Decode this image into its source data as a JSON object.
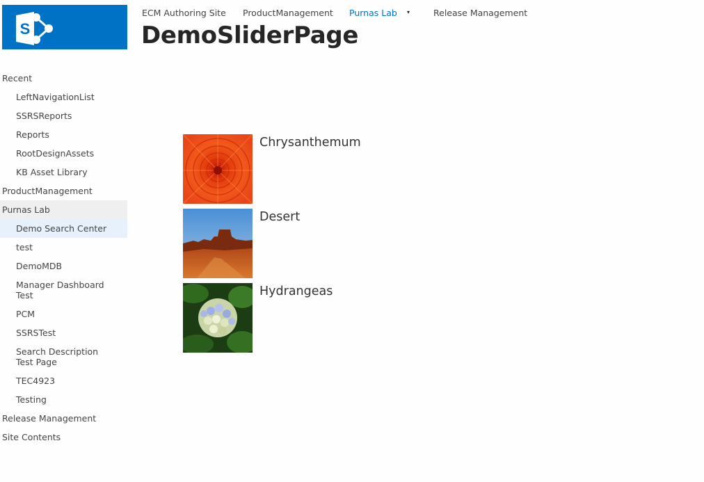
{
  "logo": {
    "icon": "sharepoint-logo-icon",
    "color": "#0072c6"
  },
  "topnav": {
    "items": [
      {
        "label": "ECM Authoring Site"
      },
      {
        "label": "ProductManagement"
      },
      {
        "label": "Purnas Lab",
        "selected": true
      },
      {
        "label": "Release Management"
      }
    ],
    "caret": "▾"
  },
  "page": {
    "title": "DemoSliderPage"
  },
  "leftnav": {
    "items": [
      {
        "label": "Recent"
      },
      {
        "label": "LeftNavigationList"
      },
      {
        "label": "SSRSReports"
      },
      {
        "label": "Reports"
      },
      {
        "label": "RootDesignAssets"
      },
      {
        "label": "KB Asset Library"
      },
      {
        "label": "ProductManagement"
      },
      {
        "label": "Purnas Lab"
      },
      {
        "label": "Demo Search Center"
      },
      {
        "label": "test"
      },
      {
        "label": "DemoMDB"
      },
      {
        "label": "Manager Dashboard Test"
      },
      {
        "label": "PCM"
      },
      {
        "label": "SSRSTest"
      },
      {
        "label": "Search Description Test Page"
      },
      {
        "label": "TEC4923"
      },
      {
        "label": "Testing"
      },
      {
        "label": "Release Management"
      },
      {
        "label": "Site Contents"
      }
    ]
  },
  "slides": [
    {
      "title": "Chrysanthemum",
      "image": "chrysanthemum-image"
    },
    {
      "title": "Desert",
      "image": "desert-image"
    },
    {
      "title": "Hydrangeas",
      "image": "hydrangeas-image"
    }
  ],
  "colors": {
    "accent": "#0072c6",
    "hover": "#e6f1fb",
    "selected": "#efefef"
  }
}
